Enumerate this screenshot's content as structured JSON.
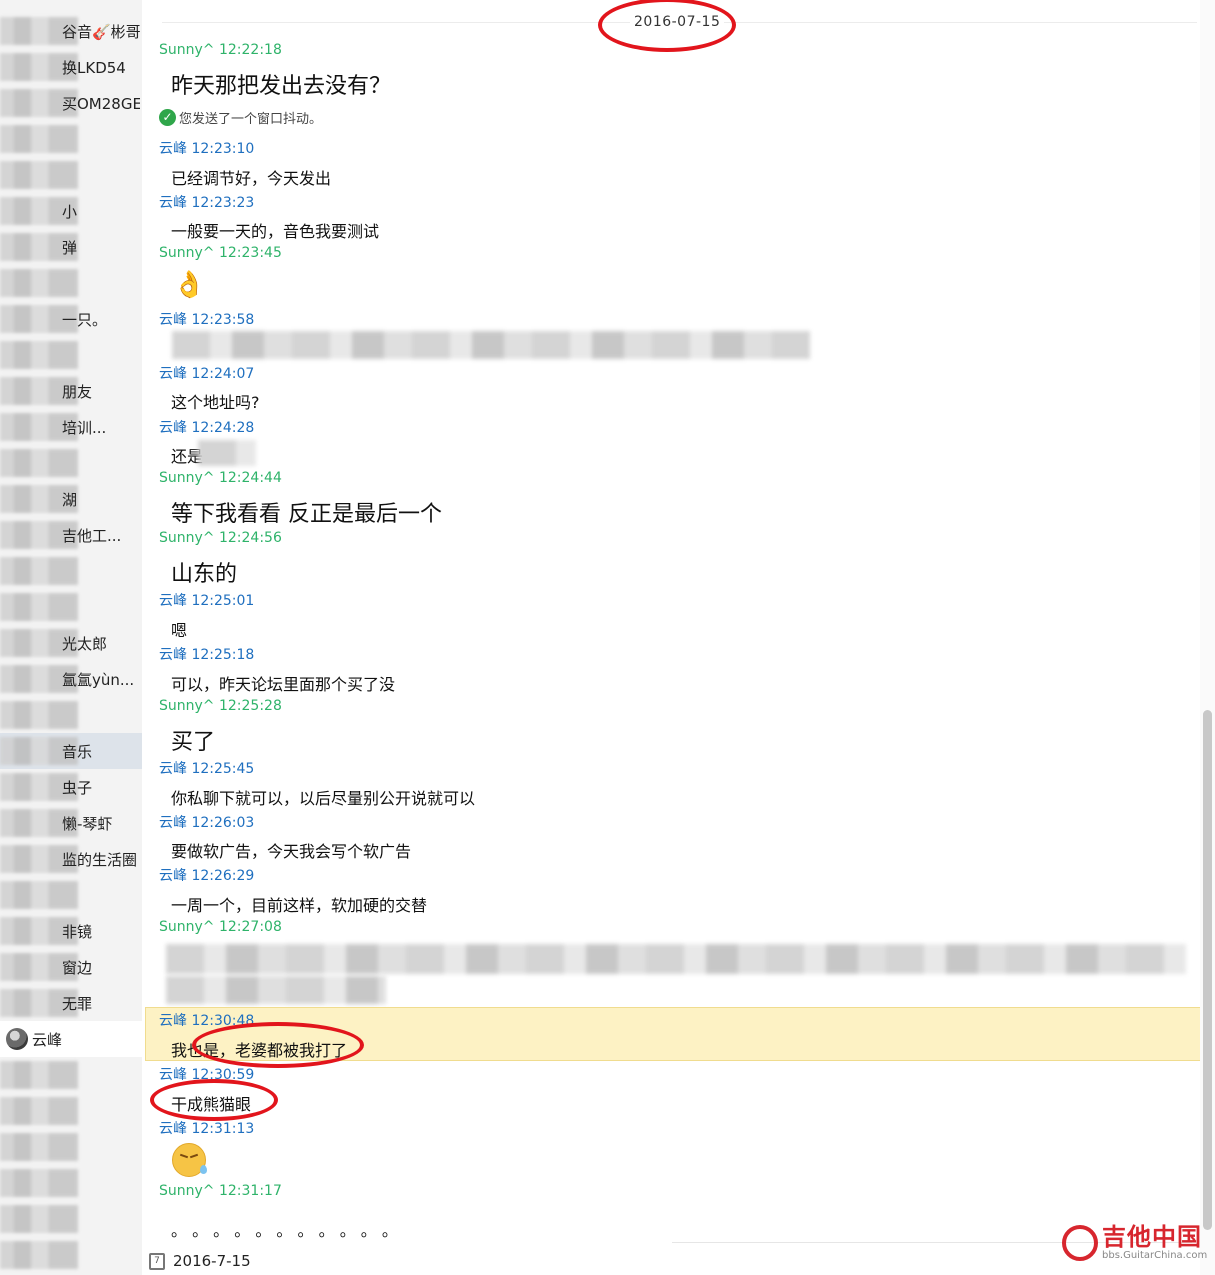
{
  "sidebar": {
    "contacts": [
      {
        "label": "谷音🎸彬哥"
      },
      {
        "label": "换LKD54"
      },
      {
        "label": "买OM28GE"
      },
      {
        "label": ""
      },
      {
        "label": ""
      },
      {
        "label": "小"
      },
      {
        "label": "弹"
      },
      {
        "label": ""
      },
      {
        "label": "一只。"
      },
      {
        "label": ""
      },
      {
        "label": "朋友"
      },
      {
        "label": "培训..."
      },
      {
        "label": ""
      },
      {
        "label": "湖"
      },
      {
        "label": "吉他工..."
      },
      {
        "label": ""
      },
      {
        "label": ""
      },
      {
        "label": "光太郎"
      },
      {
        "label": "氲氲yùn..."
      },
      {
        "label": ""
      },
      {
        "label": "音乐"
      },
      {
        "label": "虫子"
      },
      {
        "label": "懒-琴虾"
      },
      {
        "label": "监的生活圈"
      },
      {
        "label": ""
      },
      {
        "label": "非镜"
      },
      {
        "label": "窗边"
      },
      {
        "label": "无罪"
      },
      {
        "label": "云峰"
      }
    ]
  },
  "chat": {
    "date_separator": "2016-07-15",
    "system_notice": "您发送了一个窗口抖动。",
    "messages": [
      {
        "header": "Sunny^ 12:22:18",
        "text": "昨天那把发出去没有？"
      },
      {
        "header": "云峰 12:23:10",
        "text": "已经调节好，今天发出"
      },
      {
        "header": "云峰 12:23:23",
        "text": "一般要一天的，音色我要测试"
      },
      {
        "header": "Sunny^ 12:23:45",
        "text": ""
      },
      {
        "header": "云峰 12:23:58",
        "text": ""
      },
      {
        "header": "云峰 12:24:07",
        "text": "这个地址吗?"
      },
      {
        "header": "云峰 12:24:28",
        "text": "还是"
      },
      {
        "header": "Sunny^ 12:24:44",
        "text": "等下我看看 反正是最后一个"
      },
      {
        "header": "Sunny^ 12:24:56",
        "text": "山东的"
      },
      {
        "header": "云峰 12:25:01",
        "text": "嗯"
      },
      {
        "header": "云峰 12:25:18",
        "text": "可以，昨天论坛里面那个买了没"
      },
      {
        "header": "Sunny^ 12:25:28",
        "text": "买了"
      },
      {
        "header": "云峰 12:25:45",
        "text": "你私聊下就可以，以后尽量别公开说就可以"
      },
      {
        "header": "云峰 12:26:03",
        "text": "要做软广告，今天我会写个软广告"
      },
      {
        "header": "云峰 12:26:29",
        "text": "一周一个，目前这样，软加硬的交替"
      },
      {
        "header": "Sunny^ 12:27:08",
        "text": ""
      },
      {
        "header": "云峰 12:30:48",
        "text": "我也是，老婆都被我打了"
      },
      {
        "header": "云峰 12:30:59",
        "text": "干成熊猫眼"
      },
      {
        "header": "云峰 12:31:13",
        "text": ""
      },
      {
        "header": "Sunny^ 12:31:17",
        "text": "。 。 。 。 。 。 。 。 。 。 。"
      }
    ],
    "footer_date": "2016-7-15"
  },
  "watermark": {
    "main": "吉他中国",
    "sub": "bbs.GuitarChina.com"
  },
  "colors": {
    "sunny": "#2fb36a",
    "yunfeng": "#1f6fbf",
    "highlight": "#fdf2c4",
    "annotation": "#e2151c"
  }
}
